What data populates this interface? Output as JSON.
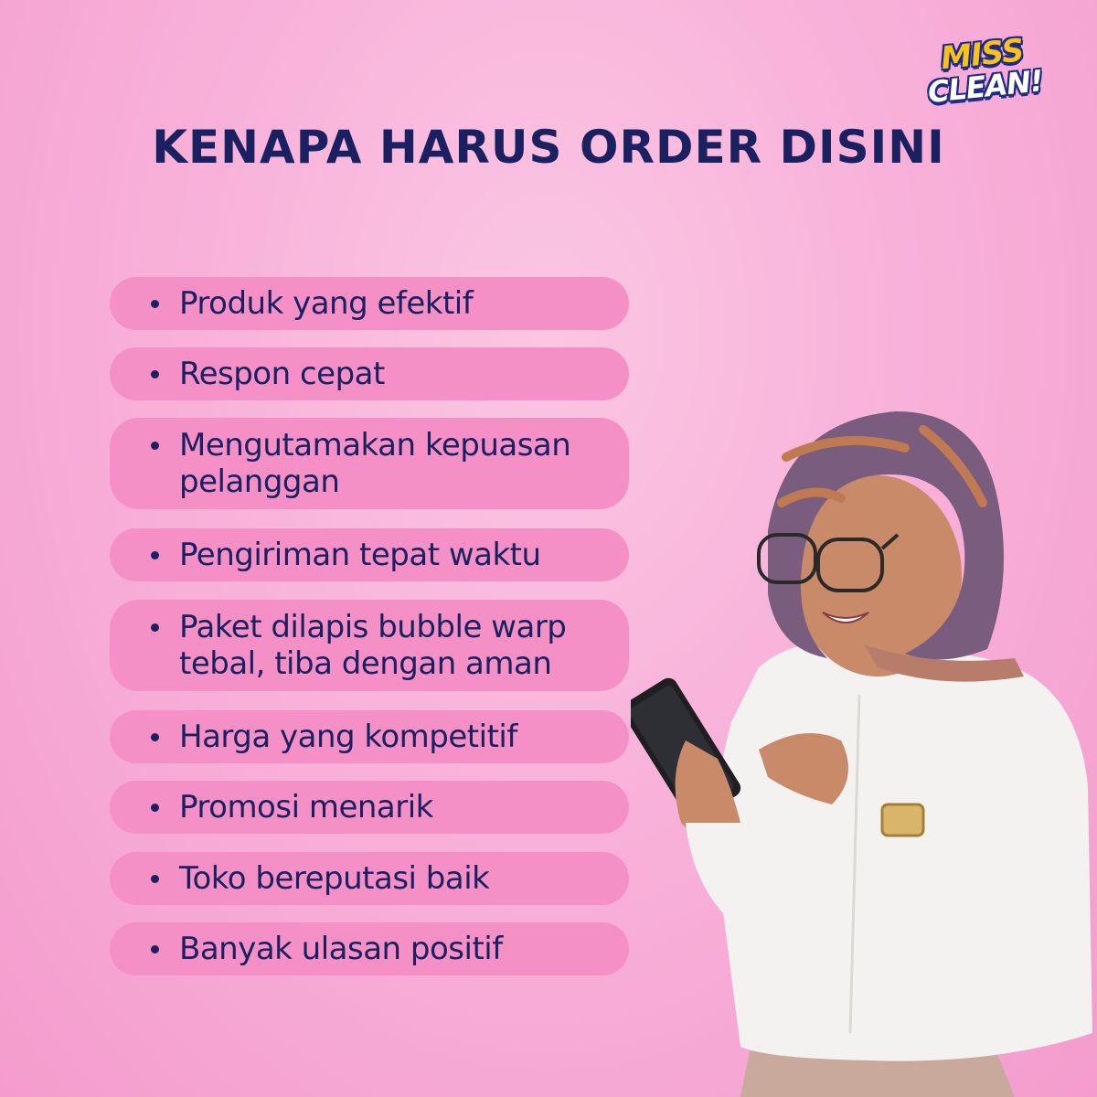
{
  "brand": {
    "line1": "MISS",
    "line2": "CLEAN!"
  },
  "title": "KENAPA HARUS ORDER DISINI",
  "reasons": [
    "Produk yang efektif",
    "Respon cepat",
    "Mengutamakan kepuasan pelanggan",
    "Pengiriman tepat waktu",
    "Paket dilapis bubble warp tebal, tiba dengan aman",
    "Harga yang kompetitif",
    "Promosi menarik",
    "Toko bereputasi baik",
    "Banyak ulasan positif"
  ],
  "colors": {
    "background": "#f8b2da",
    "pill": "#f590c6",
    "text": "#1a2060",
    "logo_yellow": "#f6c21b",
    "logo_blue": "#1f2b86"
  }
}
